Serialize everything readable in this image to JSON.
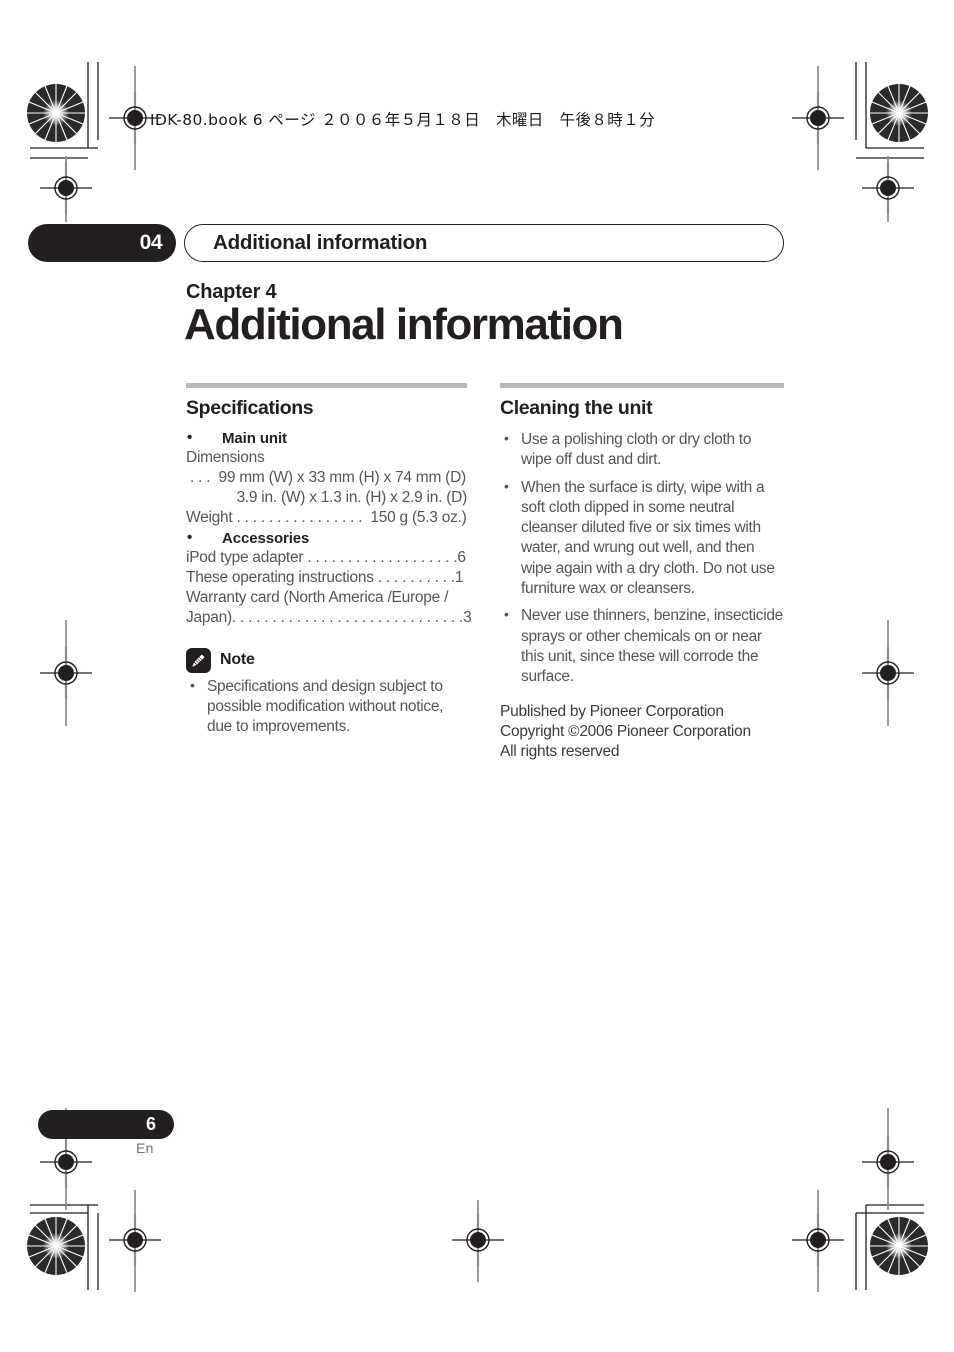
{
  "document": {
    "running_header": "IDK-80.book  6 ページ  ２００６年５月１８日　木曜日　午後８時１分",
    "page_number": "6",
    "page_language": "En"
  },
  "chapter_tab": {
    "number": "04",
    "title": "Additional information"
  },
  "chapter": {
    "label": "Chapter 4",
    "title": "Additional information"
  },
  "specifications": {
    "heading": "Specifications",
    "main_unit": {
      "bullet_label": "Main unit",
      "lines": [
        "Dimensions",
        " . . .  99 mm (W) x 33 mm (H) x 74 mm (D)",
        "3.9 in. (W) x 1.3 in. (H) x 2.9 in. (D)",
        "Weight . . . . . . . . . . . . . . . .  150 g (5.3 oz.)"
      ]
    },
    "accessories": {
      "bullet_label": "Accessories",
      "lines": [
        "iPod type adapter . . . . . . . . . . . . . . . . . . .6",
        "These operating instructions . . . . . . . . . .1",
        "Warranty card (North America /Europe /",
        "Japan). . . . . . . . . . . . . . . . . . . . . . . . . . . . .3"
      ]
    },
    "note": {
      "icon": "pencil-icon",
      "label": "Note",
      "items": [
        "Specifications and design subject to possible modification without notice, due to improvements."
      ]
    }
  },
  "cleaning": {
    "heading": "Cleaning the unit",
    "items": [
      "Use a polishing cloth or dry cloth to wipe off dust and dirt.",
      "When the surface is dirty, wipe with a soft cloth dipped in some neutral cleanser diluted five or six times with water, and wrung out well, and then wipe again with a dry cloth. Do not use furniture wax or cleansers.",
      "Never use thinners, benzine, insecticide sprays or other chemicals on or near this unit, since these will corrode the surface."
    ],
    "publisher": [
      "Published by Pioneer Corporation",
      "Copyright  ©2006 Pioneer Corporation",
      "All rights reserved"
    ]
  },
  "colors": {
    "ink_black": "#231f20",
    "body_gray": "#555658",
    "rule_gray": "#b9b9b9"
  }
}
